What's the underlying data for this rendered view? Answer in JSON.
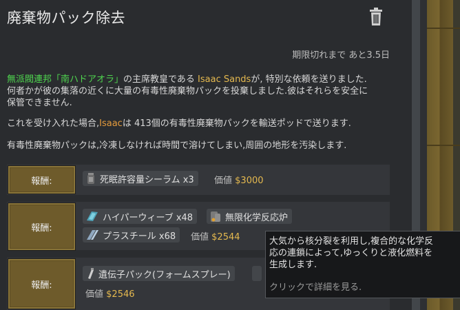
{
  "dialog": {
    "title": "廃棄物パック除去",
    "expiry": "期限切れまで あと3.5日"
  },
  "description": {
    "faction": "無派閥連邦「南ハドアオラ」",
    "text_a": "の主席教皇である ",
    "leader": "Isaac Sands",
    "text_b": "が, 特別な依頼を送りました.",
    "line2": "何者かが彼の集落の近くに大量の有毒性廃棄物パックを投棄しました.彼はそれらを安全に",
    "line3": "保管できません.",
    "p2_a": "これを受け入れた場合,",
    "p2_name": "Isaac",
    "p2_b": "は 413個の有毒性廃棄物パックを輸送ポッドで送ります.",
    "p3": "有毒性廃棄物パックは,冷凍しなければ時間で溶けてしまい,周囲の地形を汚染します."
  },
  "rewards": [
    {
      "button": "報酬:",
      "items": [
        "死眠許容量シーラム x3"
      ],
      "value_label": "価値",
      "value": "$3000"
    },
    {
      "button": "報酬:",
      "items": [
        "ハイパーウィーブ x48",
        "無限化学反応炉",
        "プラスチール x68"
      ],
      "value_label": "価値",
      "value": "$2544"
    },
    {
      "button": "報酬:",
      "items": [
        "遺伝子パック(フォームスプレー)"
      ],
      "value_label": "価値",
      "value": "$2546"
    }
  ],
  "tooltip": {
    "line1": "大気から核分裂を利用し,複合的な化学反",
    "line2": "応の連鎖によって,ゆっくりと液化燃料を",
    "line3": "生成します.",
    "hint": "クリックで詳細を見る."
  },
  "colors": {
    "faction": "#4fd64f",
    "leader": "#e5b94f",
    "name": "#e59b3c",
    "value": "#e5b94f",
    "button": "#6e5b2b"
  },
  "icons": [
    "trash-icon",
    "serum-icon",
    "hyperweave-icon",
    "reactor-icon",
    "plasteel-icon",
    "genepack-icon"
  ]
}
